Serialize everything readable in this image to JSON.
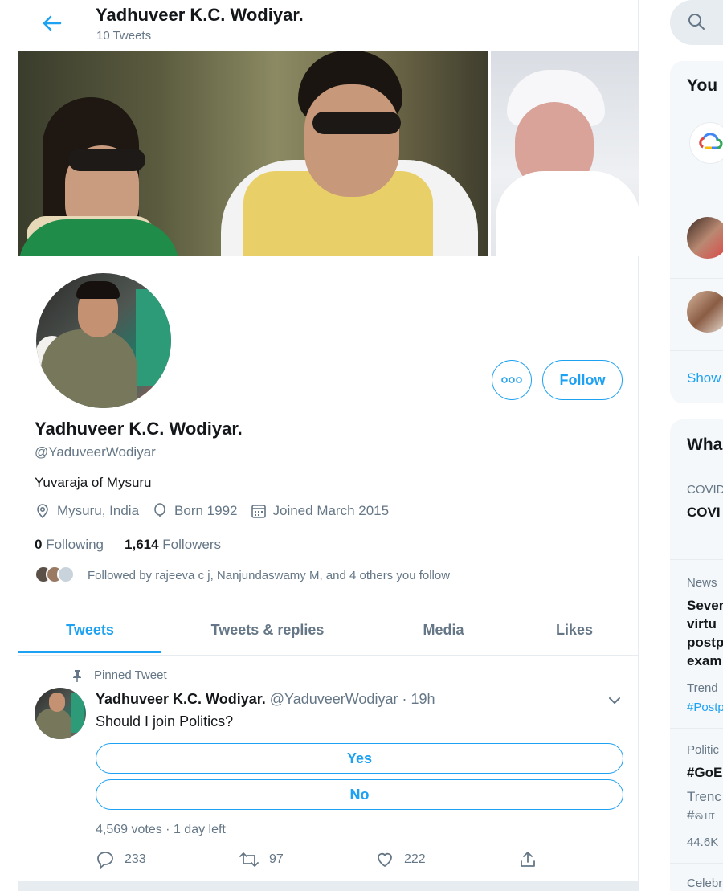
{
  "header": {
    "name": "Yadhuveer K.C. Wodiyar.",
    "tweet_count": "10 Tweets"
  },
  "profile": {
    "name": "Yadhuveer K.C. Wodiyar.",
    "handle": "@YaduveerWodiyar",
    "bio": "Yuvaraja of Mysuru",
    "location": "Mysuru, India",
    "born": "Born 1992",
    "joined": "Joined March 2015",
    "following_count": "0",
    "following_label": "Following",
    "followers_count": "1,614",
    "followers_label": "Followers",
    "followed_by": "Followed by rajeeva c j, Nanjundaswamy M, and 4 others you follow",
    "follow_label": "Follow"
  },
  "tabs": [
    {
      "label": "Tweets",
      "active": true
    },
    {
      "label": "Tweets & replies",
      "active": false
    },
    {
      "label": "Media",
      "active": false
    },
    {
      "label": "Likes",
      "active": false
    }
  ],
  "pinned_tweet": {
    "pinned_label": "Pinned Tweet",
    "author_name": "Yadhuveer K.C. Wodiyar.",
    "author_handle_time": "@YaduveerWodiyar · 19h",
    "text": "Should I join Politics?",
    "poll_options": [
      "Yes",
      "No"
    ],
    "poll_meta": "4,569 votes · 1 day left",
    "replies": "233",
    "retweets": "97",
    "likes": "222"
  },
  "sidebar": {
    "card1_heading": "You",
    "card1_footer": "Show",
    "card2_heading": "Wha",
    "trends": [
      {
        "category": "COVID",
        "title": "COVI"
      },
      {
        "category": "News",
        "title_lines": [
          "Sever",
          "virtu",
          "postp",
          "exam"
        ],
        "sub": "Trend",
        "tag": "#Postp"
      },
      {
        "category": "Politic",
        "title": "#GoE",
        "sub_lines": [
          "Trenc",
          "#வா"
        ],
        "count": "44.6K"
      },
      {
        "category": "Celebr"
      }
    ]
  },
  "colors": {
    "accent": "#1da1f2",
    "text_primary": "#14171a",
    "text_secondary": "#657786",
    "divider": "#e6ecf0"
  }
}
